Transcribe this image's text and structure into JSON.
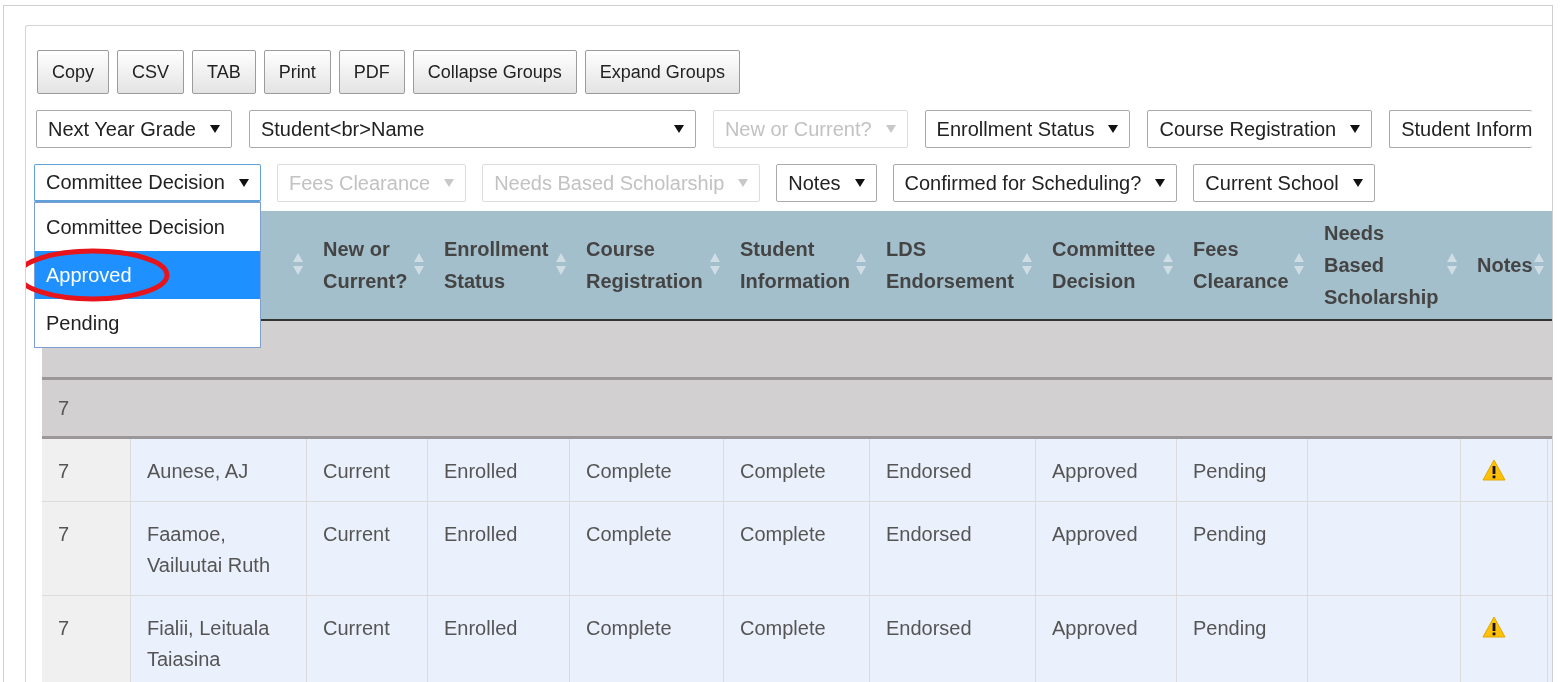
{
  "toolbar": {
    "buttons": [
      "Copy",
      "CSV",
      "TAB",
      "Print",
      "PDF",
      "Collapse Groups",
      "Expand Groups"
    ]
  },
  "filter_rows": [
    {
      "filters": [
        {
          "label": "Next Year Grade",
          "disabled": false,
          "open": false
        },
        {
          "label": "Student<br>Name",
          "disabled": false,
          "open": false
        },
        {
          "label": "New or Current?",
          "disabled": true,
          "open": false
        },
        {
          "label": "Enrollment Status",
          "disabled": false,
          "open": false
        },
        {
          "label": "Course Registration",
          "disabled": false,
          "open": false
        },
        {
          "label": "Student Inform",
          "disabled": false,
          "open": false
        }
      ]
    },
    {
      "filters": [
        {
          "label": "Committee Decision",
          "disabled": false,
          "open": true,
          "options": [
            {
              "label": "Committee Decision",
              "selected": false,
              "circled": false
            },
            {
              "label": "Approved",
              "selected": true,
              "circled": true
            },
            {
              "label": "Pending",
              "selected": false,
              "circled": false
            }
          ]
        },
        {
          "label": "Fees Clearance",
          "disabled": true,
          "open": false
        },
        {
          "label": "Needs Based Scholarship",
          "disabled": true,
          "open": false
        },
        {
          "label": "Notes",
          "disabled": false,
          "open": false
        },
        {
          "label": "Confirmed for Scheduling?",
          "disabled": false,
          "open": false
        },
        {
          "label": "Current School",
          "disabled": false,
          "open": false
        }
      ]
    }
  ],
  "table": {
    "columns": [
      "New or Current?",
      "Enrollment Status",
      "Course Registration",
      "Student Information",
      "LDS Endorsement",
      "Committee Decision",
      "Fees Clearance",
      "Needs Based Scholarship",
      "Notes"
    ],
    "rows": [
      {
        "kind": "group"
      },
      {
        "kind": "group",
        "label": "7"
      },
      {
        "kind": "data",
        "cells": [
          "7",
          "Aunese, AJ",
          "Current",
          "Enrolled",
          "Complete",
          "Complete",
          "Endorsed",
          "Approved",
          "Pending"
        ],
        "warning": true
      },
      {
        "kind": "data",
        "cells": [
          "7",
          "Faamoe, Vailuutai Ruth",
          "Current",
          "Enrolled",
          "Complete",
          "Complete",
          "Endorsed",
          "Approved",
          "Pending"
        ],
        "warning": false
      },
      {
        "kind": "data",
        "cells": [
          "7",
          "Fialii, Leituala Taiasina",
          "Current",
          "Enrolled",
          "Complete",
          "Complete",
          "Endorsed",
          "Approved",
          "Pending"
        ],
        "warning": true
      }
    ]
  }
}
